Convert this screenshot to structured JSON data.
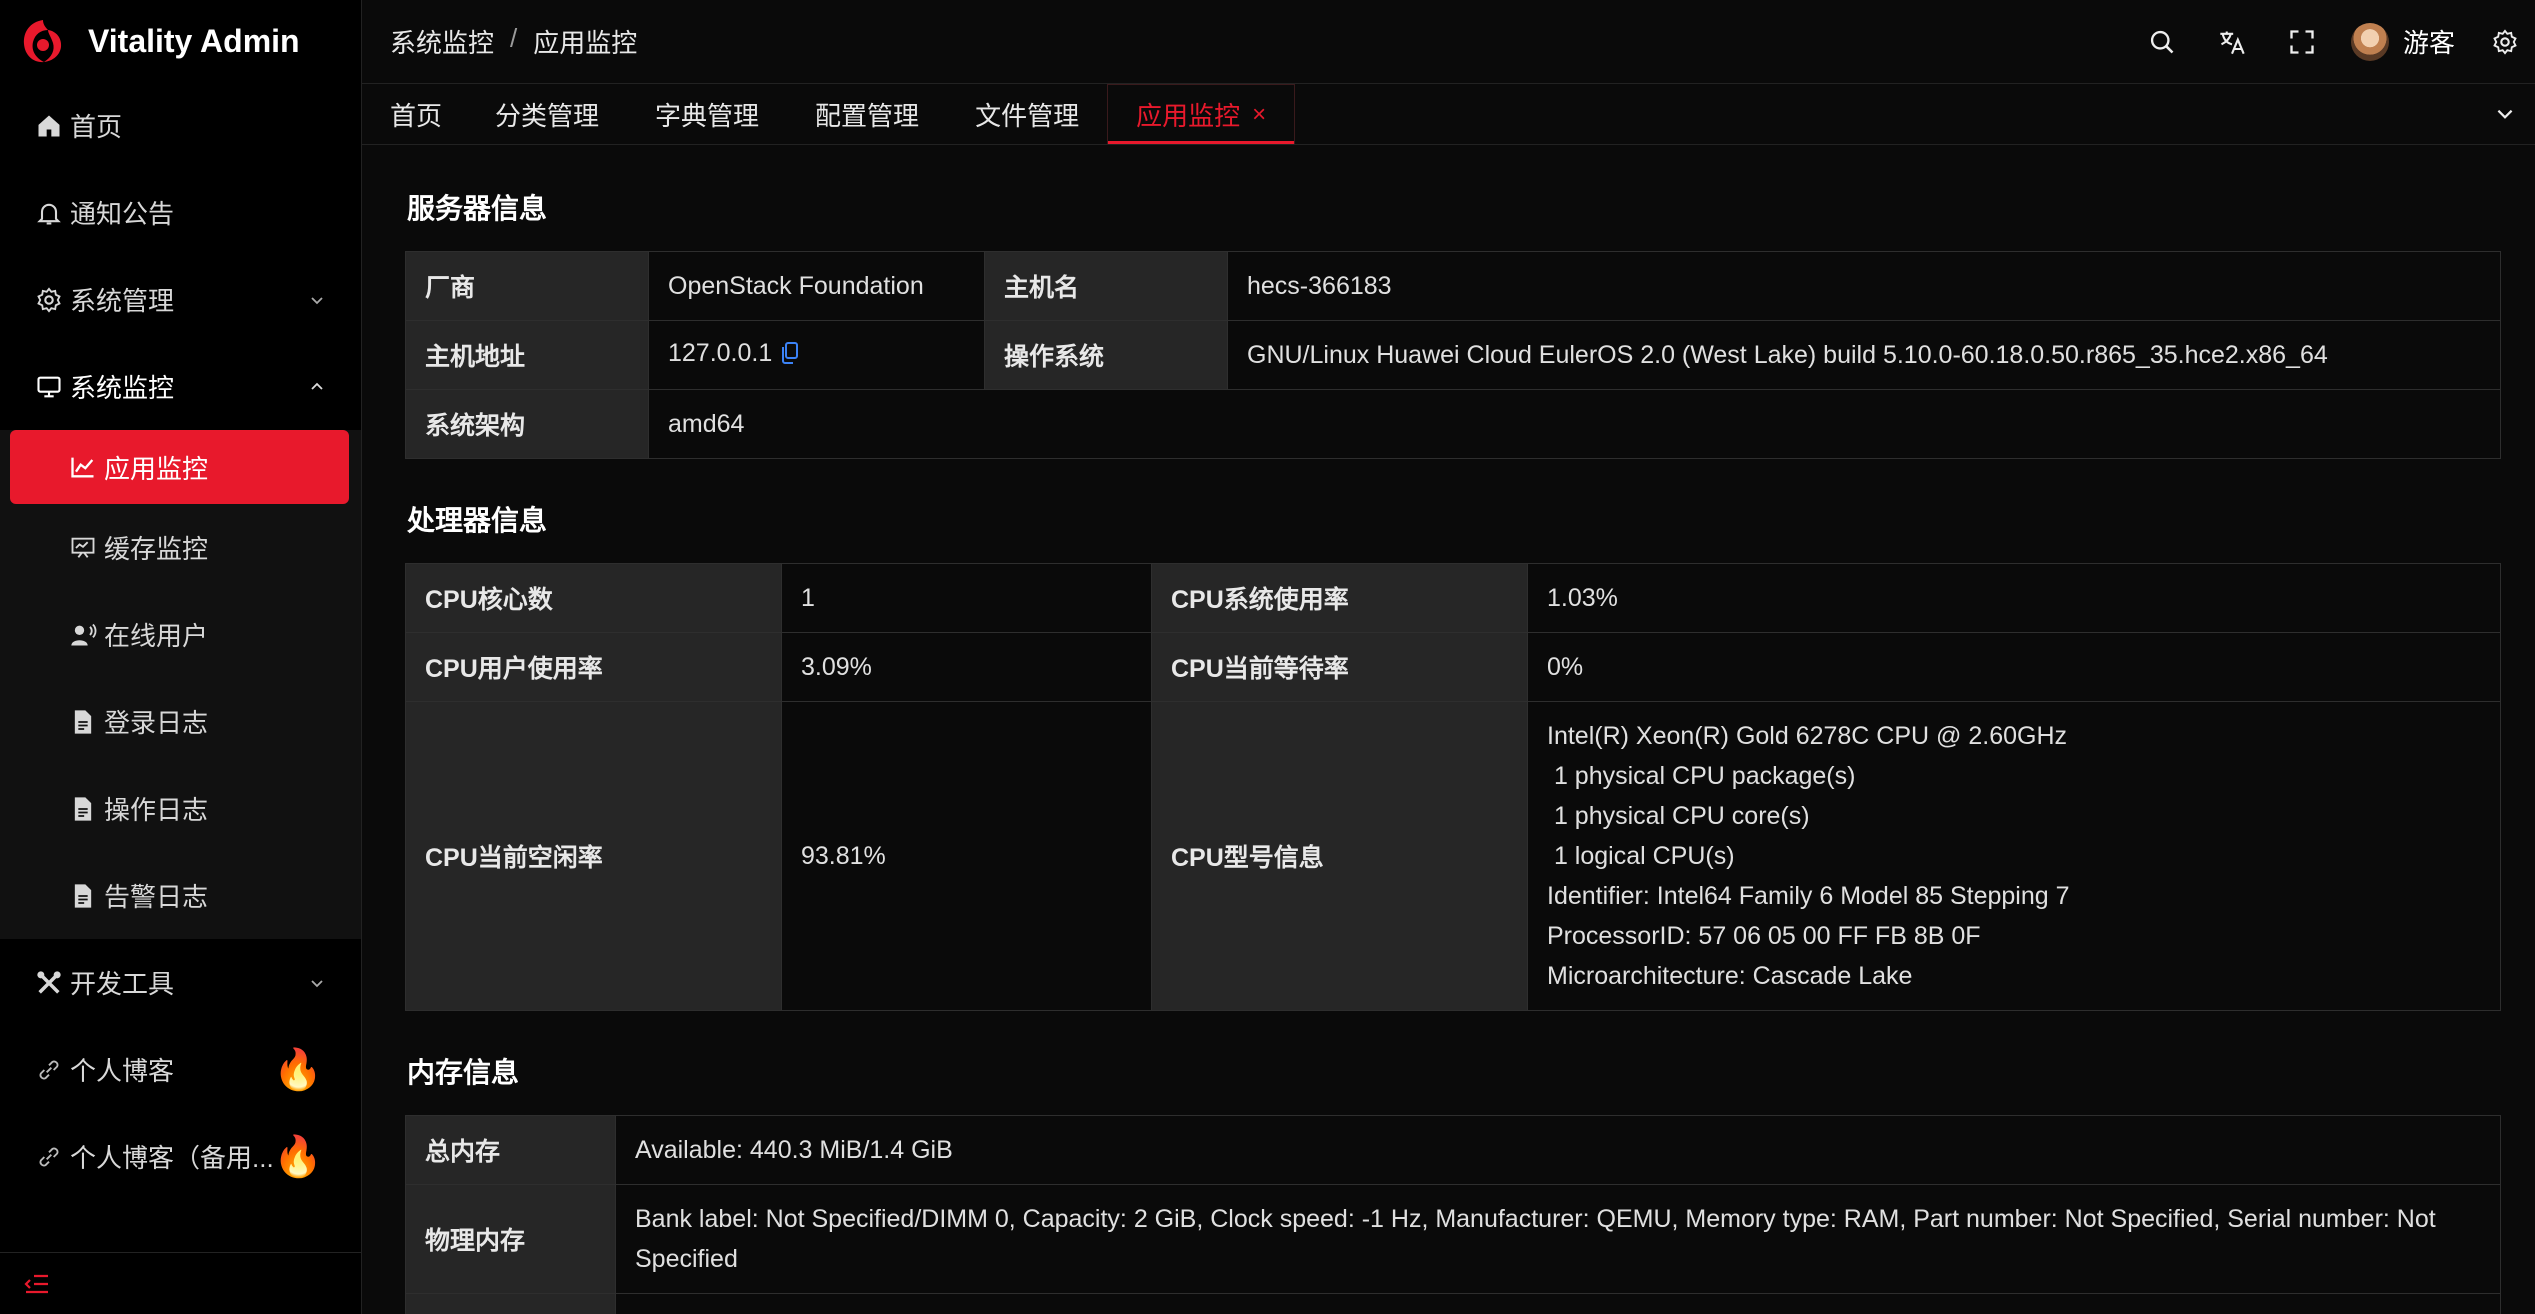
{
  "brand": {
    "title": "Vitality Admin",
    "accent": "#e8192c"
  },
  "sidebar": {
    "items": [
      {
        "label": "首页",
        "icon": "home-icon"
      },
      {
        "label": "通知公告",
        "icon": "bell-icon"
      },
      {
        "label": "系统管理",
        "icon": "gear-icon",
        "expandable": true
      },
      {
        "label": "系统监控",
        "icon": "monitor-icon",
        "expandable": true,
        "expanded": true
      },
      {
        "label": "开发工具",
        "icon": "tools-icon",
        "expandable": true
      },
      {
        "label": "个人博客",
        "icon": "link-icon",
        "badge": "fire-icon"
      },
      {
        "label": "个人博客（备用...",
        "icon": "link-icon",
        "badge": "fire-icon"
      }
    ],
    "submenu": [
      {
        "label": "应用监控",
        "icon": "chart-icon",
        "active": true
      },
      {
        "label": "缓存监控",
        "icon": "cache-icon"
      },
      {
        "label": "在线用户",
        "icon": "user-icon"
      },
      {
        "label": "登录日志",
        "icon": "doc-icon"
      },
      {
        "label": "操作日志",
        "icon": "doc-icon"
      },
      {
        "label": "告警日志",
        "icon": "doc-icon"
      }
    ]
  },
  "header": {
    "breadcrumb": [
      "系统监控",
      "应用监控"
    ],
    "separator": "/",
    "username": "游客"
  },
  "tabs": [
    {
      "label": "首页"
    },
    {
      "label": "分类管理"
    },
    {
      "label": "字典管理"
    },
    {
      "label": "配置管理"
    },
    {
      "label": "文件管理"
    },
    {
      "label": "应用监控",
      "active": true,
      "close": "×"
    }
  ],
  "server": {
    "title": "服务器信息",
    "vendor_label": "厂商",
    "vendor": "OpenStack Foundation",
    "hostname_label": "主机名",
    "hostname": "hecs-366183",
    "address_label": "主机地址",
    "address": "127.0.0.1",
    "os_label": "操作系统",
    "os": "GNU/Linux Huawei Cloud EulerOS 2.0 (West Lake) build 5.10.0-60.18.0.50.r865_35.hce2.x86_64",
    "arch_label": "系统架构",
    "arch": "amd64"
  },
  "cpu": {
    "title": "处理器信息",
    "cores_label": "CPU核心数",
    "cores": "1",
    "sys_label": "CPU系统使用率",
    "sys": "1.03%",
    "user_label": "CPU用户使用率",
    "user": "3.09%",
    "wait_label": "CPU当前等待率",
    "wait": "0%",
    "idle_label": "CPU当前空闲率",
    "idle": "93.81%",
    "model_label": "CPU型号信息",
    "model_lines": [
      "Intel(R) Xeon(R) Gold 6278C CPU @ 2.60GHz",
      " 1 physical CPU package(s)",
      " 1 physical CPU core(s)",
      " 1 logical CPU(s)",
      "Identifier: Intel64 Family 6 Model 85 Stepping 7",
      "ProcessorID: 57 06 05 00 FF FB 8B 0F",
      "Microarchitecture: Cascade Lake"
    ]
  },
  "memory": {
    "title": "内存信息",
    "total_label": "总内存",
    "total": "Available: 440.3 MiB/1.4 GiB",
    "physical_label": "物理内存",
    "physical": "Bank label: Not Specified/DIMM 0, Capacity: 2 GiB, Clock speed: -1 Hz, Manufacturer: QEMU, Memory type: RAM, Part number: Not Specified, Serial number: Not Specified"
  }
}
